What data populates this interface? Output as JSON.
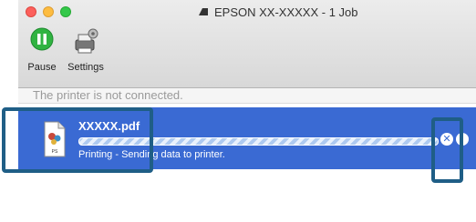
{
  "window": {
    "title": "EPSON XX-XXXXX - 1 Job",
    "traffic_lights": [
      "close",
      "minimize",
      "zoom"
    ]
  },
  "toolbar": {
    "pause_label": "Pause",
    "settings_label": "Settings",
    "pause_icon": "pause-icon",
    "settings_icon": "gear-printer-icon"
  },
  "status": {
    "message": "The printer is not connected."
  },
  "job": {
    "name": "XXXXX.pdf",
    "status": "Printing - Sending data to printer.",
    "file_badge": "PS",
    "cancel_icon": "cancel-icon",
    "info_icon": "info-icon"
  },
  "colors": {
    "selection": "#3a6ad3",
    "pause_green": "#30b341",
    "callout": "#1f5e86"
  }
}
